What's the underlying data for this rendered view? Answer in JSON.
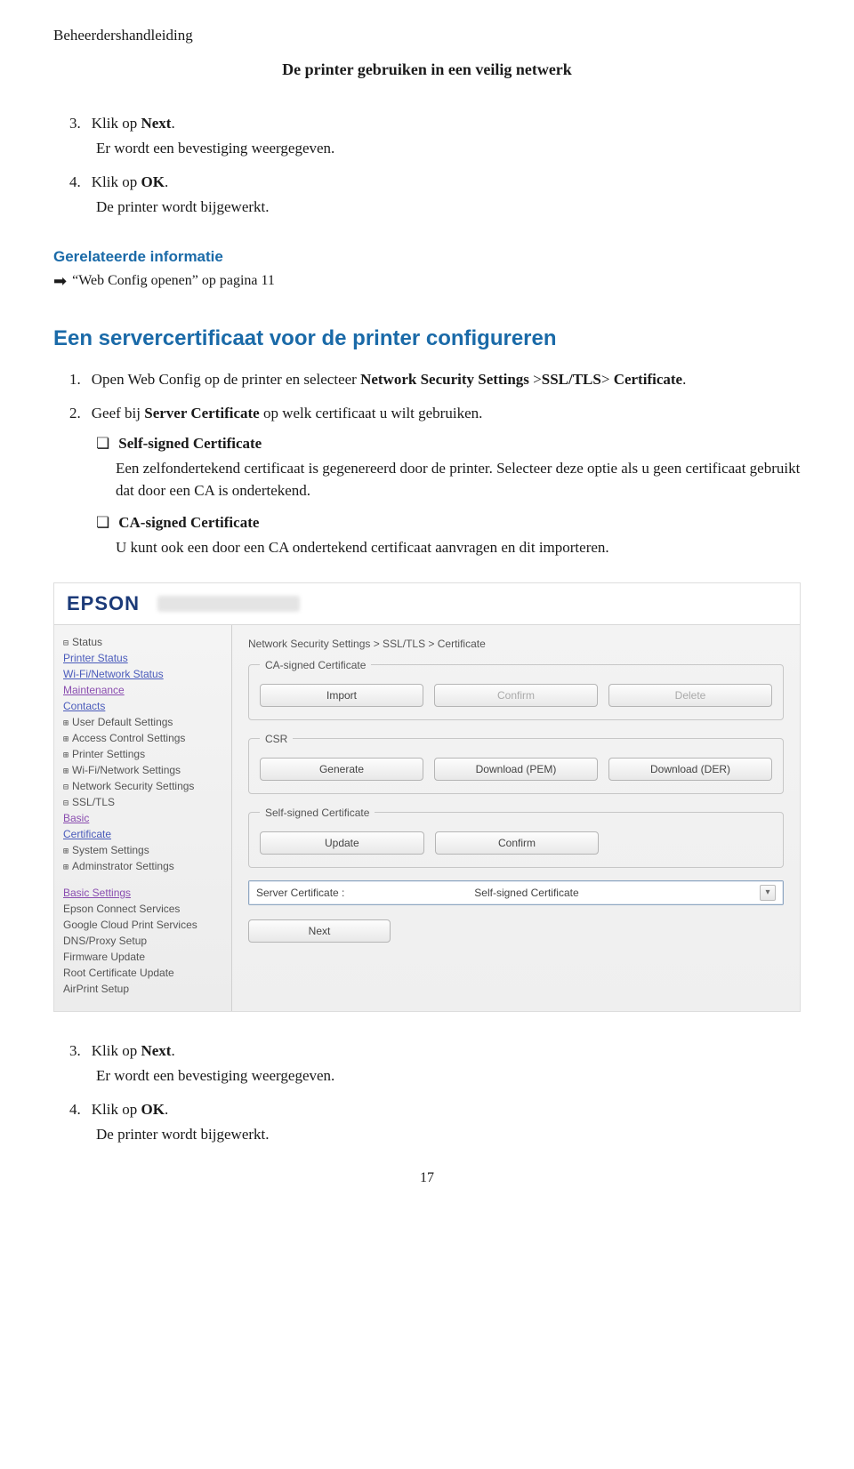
{
  "doc": {
    "header": "Beheerdershandleiding",
    "subtitle": "De printer gebruiken in een veilig netwerk"
  },
  "top_steps": {
    "s3_num": "3.",
    "s3_text_a": "Klik op ",
    "s3_bold": "Next",
    "s3_text_b": ".",
    "s3_note": "Er wordt een bevestiging weergegeven.",
    "s4_num": "4.",
    "s4_text_a": "Klik op ",
    "s4_bold": "OK",
    "s4_text_b": ".",
    "s4_note": "De printer wordt bijgewerkt."
  },
  "related": {
    "heading": "Gerelateerde informatie",
    "link_text": "“Web Config openen” op pagina 11"
  },
  "section": {
    "title": "Een servercertificaat voor de printer configureren",
    "s1_num": "1.",
    "s1_a": "Open Web Config op de printer en selecteer ",
    "s1_b1": "Network Security Settings",
    "s1_mid1": " >",
    "s1_b2": "SSL/TLS",
    "s1_mid2": "> ",
    "s1_b3": "Certificate",
    "s1_end": ".",
    "s2_num": "2.",
    "s2_a": "Geef bij ",
    "s2_bold": "Server Certificate",
    "s2_b": " op welk certificaat u wilt gebruiken.",
    "b1_label": "Self-signed Certificate",
    "b1_desc": "Een zelfondertekend certificaat is gegenereerd door de printer. Selecteer deze optie als u geen certificaat gebruikt dat door een CA is ondertekend.",
    "b2_label": "CA-signed Certificate",
    "b2_desc": "U kunt ook een door een CA ondertekend certificaat aanvragen en dit importeren."
  },
  "epson": {
    "logo": "EPSON",
    "breadcrumb": "Network Security Settings > SSL/TLS > Certificate",
    "group_ca": "CA-signed Certificate",
    "btn_import": "Import",
    "btn_confirm": "Confirm",
    "btn_delete": "Delete",
    "group_csr": "CSR",
    "btn_generate": "Generate",
    "btn_dl_pem": "Download (PEM)",
    "btn_dl_der": "Download (DER)",
    "group_self": "Self-signed Certificate",
    "btn_update": "Update",
    "sel_label": "Server Certificate :",
    "sel_value": "Self-signed Certificate",
    "btn_next": "Next",
    "nav": {
      "status": "Status",
      "printer_status": "Printer Status",
      "wifi_status": "Wi-Fi/Network Status",
      "maintenance": "Maintenance",
      "contacts": "Contacts",
      "user_default": "User Default Settings",
      "access_control": "Access Control Settings",
      "printer_settings": "Printer Settings",
      "wifi_settings": "Wi-Fi/Network Settings",
      "net_sec": "Network Security Settings",
      "ssltls": "SSL/TLS",
      "basic": "Basic",
      "certificate": "Certificate",
      "system": "System Settings",
      "admin": "Adminstrator Settings",
      "basic_heading": "Basic Settings",
      "epson_connect": "Epson Connect Services",
      "gcp": "Google Cloud Print Services",
      "dns": "DNS/Proxy Setup",
      "fw": "Firmware Update",
      "root_cert": "Root Certificate Update",
      "airprint": "AirPrint Setup"
    }
  },
  "bottom_steps": {
    "s3_num": "3.",
    "s3_text_a": "Klik op ",
    "s3_bold": "Next",
    "s3_text_b": ".",
    "s3_note": "Er wordt een bevestiging weergegeven.",
    "s4_num": "4.",
    "s4_text_a": "Klik op ",
    "s4_bold": "OK",
    "s4_text_b": ".",
    "s4_note": "De printer wordt bijgewerkt."
  },
  "page_number": "17"
}
